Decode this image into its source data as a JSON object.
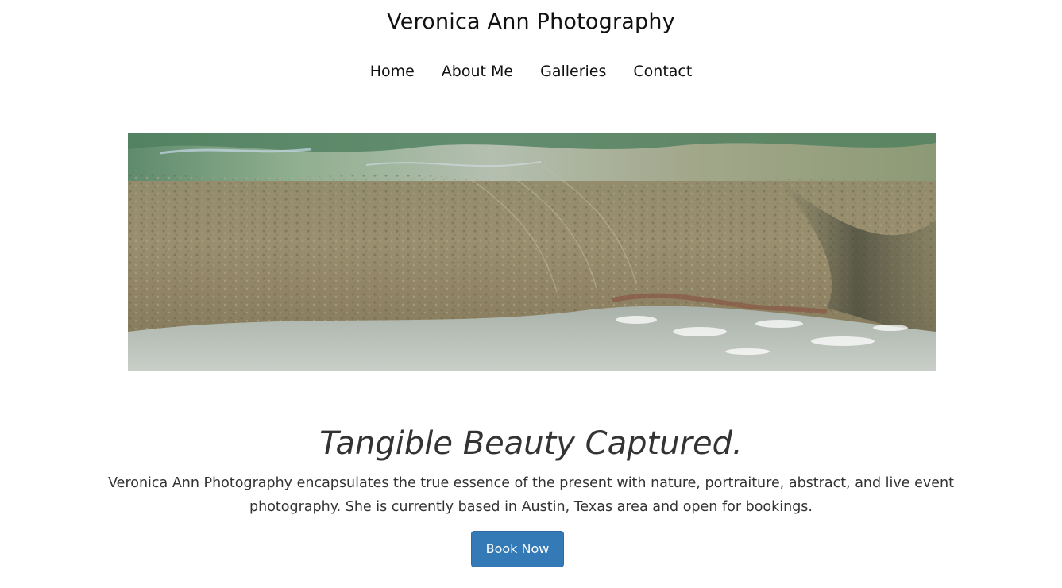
{
  "header": {
    "site_title": "Veronica Ann Photography"
  },
  "nav": {
    "items": [
      {
        "label": "Home"
      },
      {
        "label": "About Me"
      },
      {
        "label": "Galleries"
      },
      {
        "label": "Contact"
      }
    ]
  },
  "hero": {
    "image_subject": "rock-water-photo"
  },
  "main": {
    "tagline": "Tangible Beauty Captured.",
    "intro_line1": "Veronica Ann Photography encapsulates the true essence of the present with nature, portraiture, abstract, and live event",
    "intro_line2": "photography. She is currently based in Austin, Texas area and open for bookings.",
    "cta_label": "Book Now"
  },
  "colors": {
    "background": "#ffffff",
    "text": "#333333",
    "button": "#337ab7",
    "button_text": "#ffffff"
  }
}
